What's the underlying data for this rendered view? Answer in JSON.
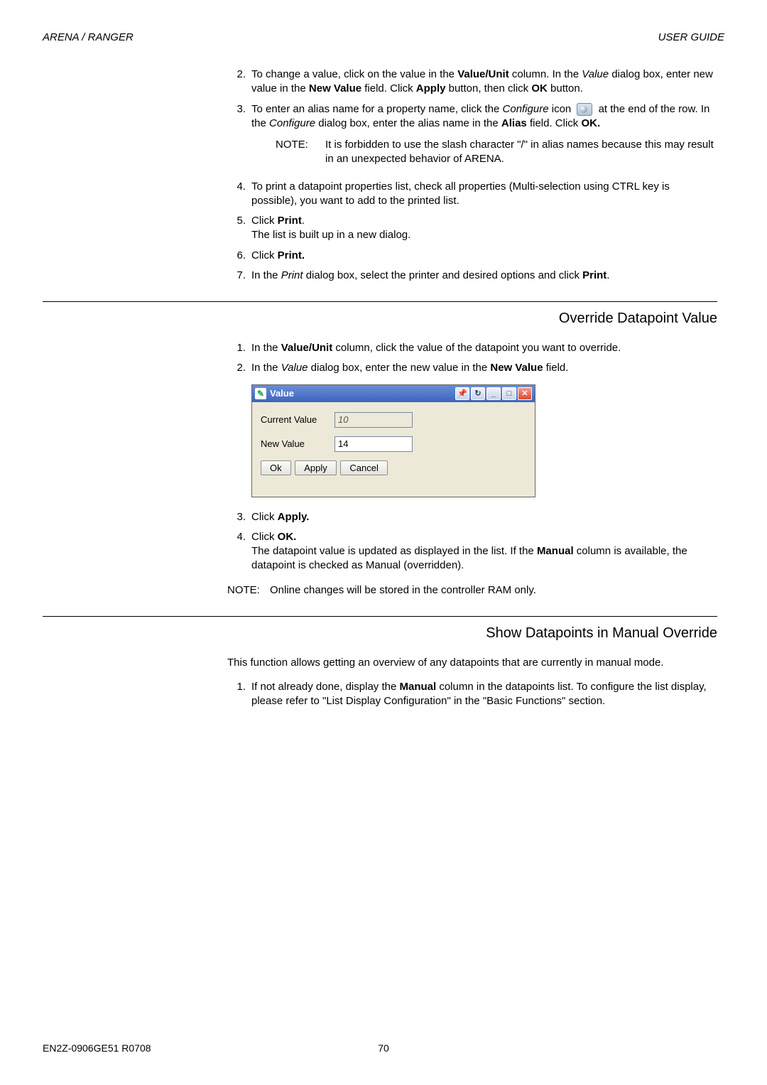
{
  "header": {
    "left": "ARENA / RANGER",
    "right": "USER GUIDE"
  },
  "top_list": {
    "i2": {
      "num": "2.",
      "a": "To change a value, click on the value in the ",
      "b": "Value/Unit",
      "c": " column. In the ",
      "d": "Value",
      "e": " dialog box, enter new value in the ",
      "f": "New Value",
      "g": " field. Click ",
      "h": "Apply",
      "i": " button, then click ",
      "j": "OK",
      "k": " button."
    },
    "i3": {
      "num": "3.",
      "a": "To enter an alias name for a property name, click the ",
      "b": "Configure",
      "c": " icon ",
      "d": " at the end of the row. In the ",
      "e": "Configure",
      "f": " dialog box, enter the alias name in the ",
      "g": "Alias",
      "h": " field. Click ",
      "i": "OK."
    },
    "note": {
      "label": "NOTE:",
      "text": "It is forbidden to use the slash character \"/\" in alias names because this may result in an unexpected behavior of ARENA."
    },
    "i4": {
      "num": "4.",
      "text": "To print a datapoint properties list, check all properties (Multi-selection using CTRL key is possible), you want to add to the printed list."
    },
    "i5": {
      "num": "5.",
      "a": "Click ",
      "b": "Print",
      "c": ".",
      "d": "The list is built up in a new dialog."
    },
    "i6": {
      "num": "6.",
      "a": "Click ",
      "b": "Print."
    },
    "i7": {
      "num": "7.",
      "a": "In the ",
      "b": "Print",
      "c": " dialog box, select the printer and desired options and click ",
      "d": "Print",
      "e": "."
    }
  },
  "section1": {
    "title": "Override Datapoint Value",
    "i1": {
      "num": "1.",
      "a": "In the ",
      "b": "Value/Unit",
      "c": " column, click the value of the datapoint you want to override."
    },
    "i2": {
      "num": "2.",
      "a": "In the ",
      "b": "Value",
      "c": " dialog box, enter the new value in the ",
      "d": "New Value",
      "e": " field."
    },
    "dialog": {
      "title": "Value",
      "current_label": "Current Value",
      "current_value": "10",
      "new_label": "New Value",
      "new_value": "14",
      "ok": "Ok",
      "apply": "Apply",
      "cancel": "Cancel"
    },
    "i3": {
      "num": "3.",
      "a": "Click ",
      "b": "Apply."
    },
    "i4": {
      "num": "4.",
      "a": "Click ",
      "b": "OK.",
      "c": "The datapoint value is updated as displayed in the list. If the ",
      "d": "Manual",
      "e": " column is available, the datapoint is checked as Manual (overridden)."
    },
    "note": {
      "label": "NOTE:",
      "text": "Online changes will be stored in the controller RAM only."
    }
  },
  "section2": {
    "title": "Show Datapoints in Manual Override",
    "intro": "This function allows getting an overview of any datapoints that are currently in manual mode.",
    "i1": {
      "num": "1.",
      "a": "If not already done, display the ",
      "b": "Manual",
      "c": " column in the datapoints list. To configure the list display, please refer to \"List Display Configuration\" in the \"Basic Functions\" section."
    }
  },
  "footer": {
    "left": "EN2Z-0906GE51 R0708",
    "center": "70"
  }
}
